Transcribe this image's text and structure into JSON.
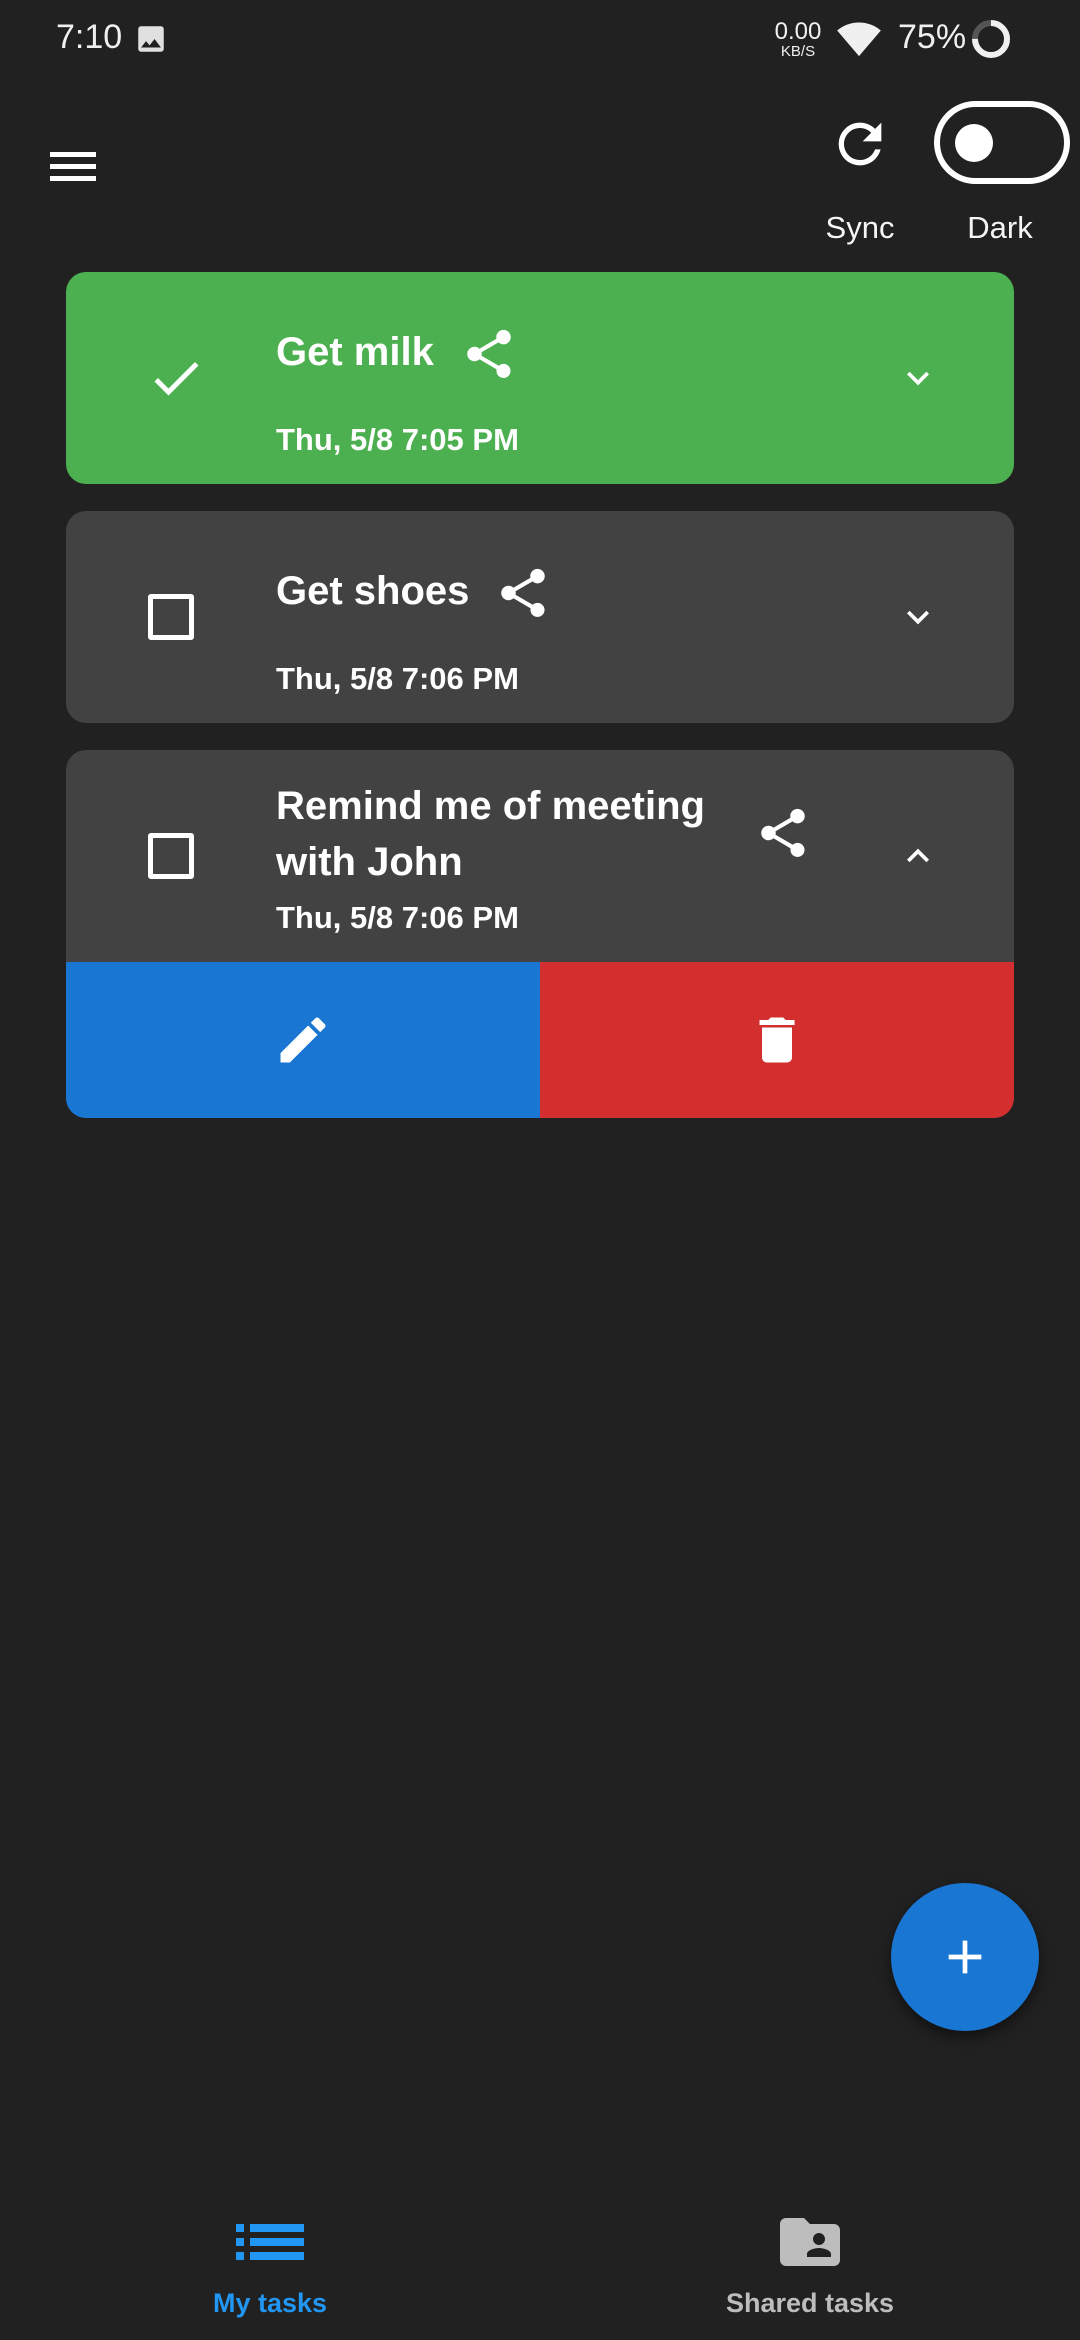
{
  "status_bar": {
    "time": "7:10",
    "net_speed_value": "0.00",
    "net_speed_unit": "KB/S",
    "battery": "75%"
  },
  "top_bar": {
    "sync_label": "Sync",
    "dark_label": "Dark",
    "dark_mode_enabled": false
  },
  "tasks": [
    {
      "title": "Get milk",
      "date": "Thu, 5/8 7:05 PM",
      "completed": true,
      "expanded": false
    },
    {
      "title": "Get shoes",
      "date": "Thu, 5/8 7:06 PM",
      "completed": false,
      "expanded": false
    },
    {
      "title": "Remind me of meeting with John",
      "date": "Thu, 5/8 7:06 PM",
      "completed": false,
      "expanded": true
    }
  ],
  "bottom_nav": {
    "my_tasks_label": "My tasks",
    "shared_tasks_label": "Shared tasks",
    "active": "my_tasks"
  },
  "colors": {
    "background": "#212121",
    "completed_card": "#4caf50",
    "pending_card": "#424242",
    "edit": "#1976d2",
    "delete": "#d32f2f",
    "accent": "#2196f3"
  },
  "icons": [
    "menu-icon",
    "sync-icon",
    "check-icon",
    "share-icon",
    "chevron-down-icon",
    "chevron-up-icon",
    "edit-icon",
    "delete-icon",
    "add-icon",
    "list-icon",
    "shared-folder-icon"
  ]
}
